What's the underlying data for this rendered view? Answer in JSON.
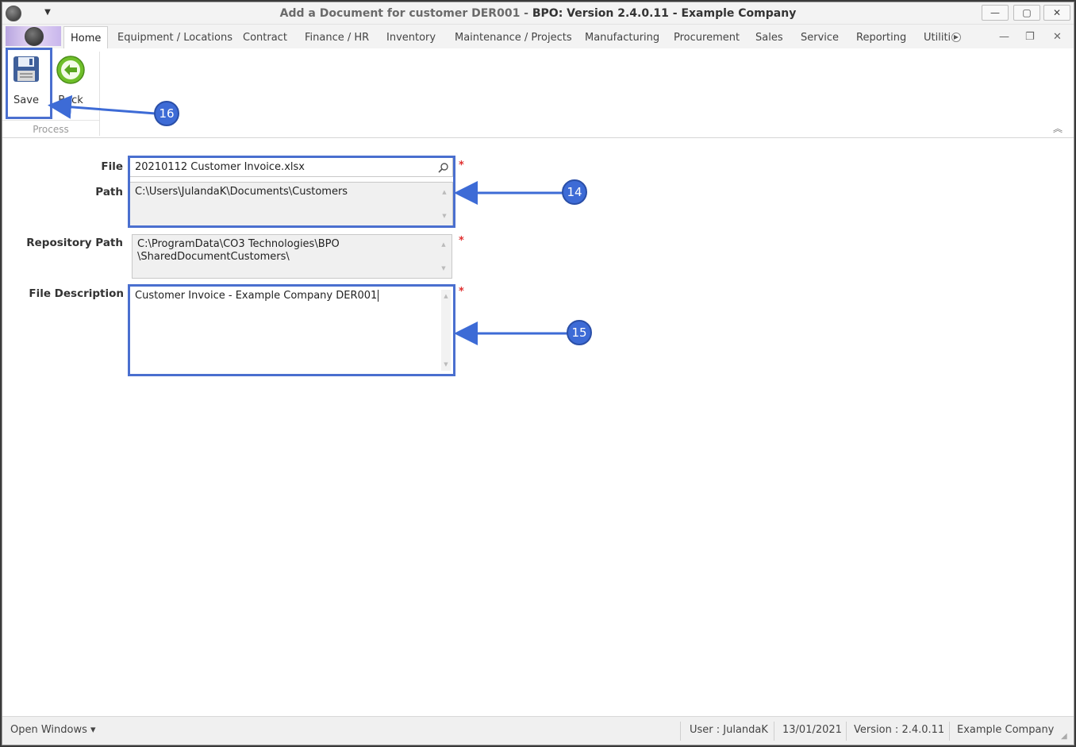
{
  "window": {
    "title_prefix": "Add a Document for customer DER001 - ",
    "title_main": "BPO: Version 2.4.0.11 - Example Company",
    "minimize": "—",
    "maximize": "▢",
    "close": "✕"
  },
  "tabs": {
    "home": "Home",
    "equipment": "Equipment / Locations",
    "contract": "Contract",
    "finance": "Finance / HR",
    "inventory": "Inventory",
    "maintenance": "Maintenance / Projects",
    "manufacturing": "Manufacturing",
    "procurement": "Procurement",
    "sales": "Sales",
    "service": "Service",
    "reporting": "Reporting",
    "utilities": "Utiliti"
  },
  "ribbon": {
    "save_label": "Save",
    "back_label": "Back",
    "group_process": "Process"
  },
  "form": {
    "file_label": "File",
    "file_value": "20210112 Customer Invoice.xlsx",
    "path_label": "Path",
    "path_value": "C:\\Users\\JulandaK\\Documents\\Customers",
    "repo_label": "Repository Path",
    "repo_value_line1": "C:\\ProgramData\\CO3 Technologies\\BPO",
    "repo_value_line2": "\\SharedDocumentCustomers\\",
    "desc_label": "File Description",
    "desc_value": "Customer Invoice - Example Company DER001",
    "required_mark": "*"
  },
  "callouts": {
    "c14": "14",
    "c15": "15",
    "c16": "16"
  },
  "status": {
    "open_windows": "Open Windows ▾",
    "user": "User : JulandaK",
    "date": "13/01/2021",
    "version": "Version : 2.4.0.11",
    "company": "Example Company"
  },
  "icons": {
    "save": "floppy-disk-icon",
    "back": "green-back-arrow-icon",
    "search": "magnifier-icon"
  },
  "colors": {
    "callout_blue": "#3d6bd6",
    "required_red": "#e03030"
  }
}
